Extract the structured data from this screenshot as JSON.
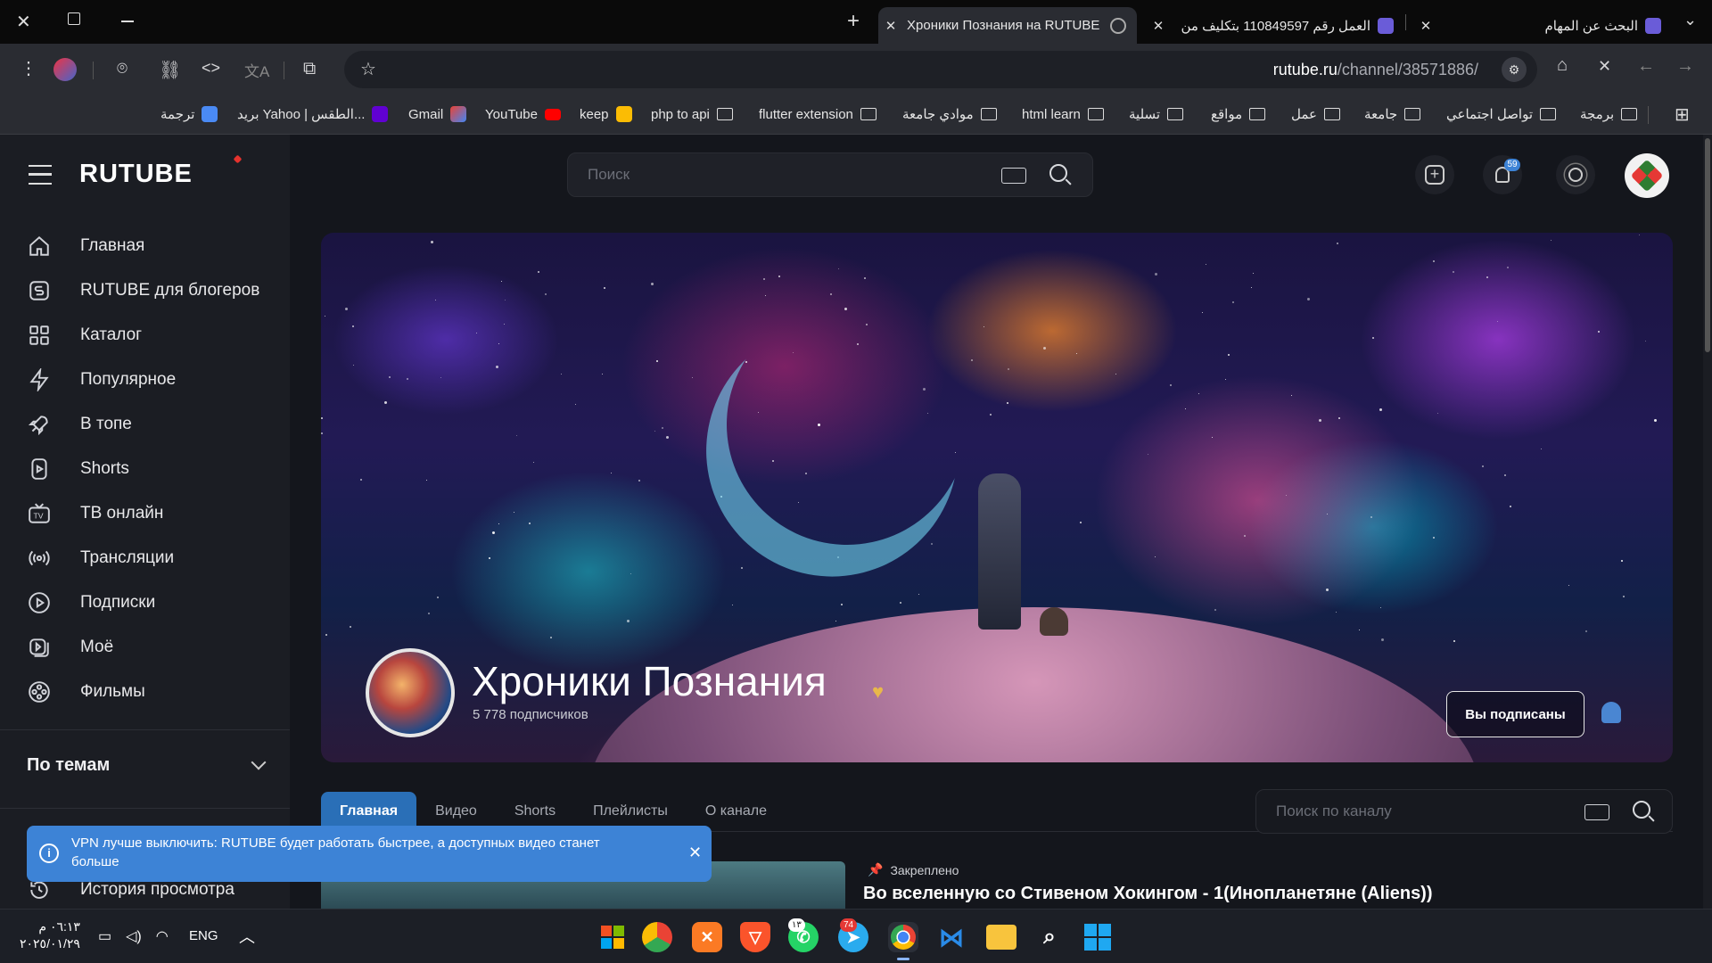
{
  "browser": {
    "tabs": [
      {
        "title": "Хроники Познания на RUTUBE",
        "active": true
      },
      {
        "title": "العمل رقم 110849597 بتكليف من",
        "active": false
      },
      {
        "title": "البحث عن المهام",
        "active": false
      }
    ],
    "url_domain": "rutube.ru",
    "url_path": "/channel/38571886/",
    "bookmarks": [
      "ترجمة",
      "بريد Yahoo | الطقس...",
      "Gmail",
      "YouTube",
      "keep",
      "php to api",
      "flutter extension",
      "موادي جامعة",
      "html learn",
      "تسلية",
      "مواقع",
      "عمل",
      "جامعة",
      "تواصل اجتماعي",
      "برمجة"
    ]
  },
  "header": {
    "logo": "RUTUBE",
    "search_placeholder": "Поиск",
    "notifications_count": "59"
  },
  "sidebar": {
    "items": [
      {
        "label": "Главная",
        "icon": "home-icon"
      },
      {
        "label": "RUTUBE для блогеров",
        "icon": "studio-icon"
      },
      {
        "label": "Каталог",
        "icon": "grid-icon"
      },
      {
        "label": "Популярное",
        "icon": "lightning-icon"
      },
      {
        "label": "В топе",
        "icon": "rocket-icon"
      },
      {
        "label": "Shorts",
        "icon": "shorts-icon"
      },
      {
        "label": "ТВ онлайн",
        "icon": "tv-icon"
      },
      {
        "label": "Трансляции",
        "icon": "broadcast-icon"
      },
      {
        "label": "Подписки",
        "icon": "subscriptions-icon"
      },
      {
        "label": "Моё",
        "icon": "library-icon"
      },
      {
        "label": "Фильмы",
        "icon": "film-reel-icon"
      }
    ],
    "section_title": "По темам",
    "history_label": "История просмотра"
  },
  "channel": {
    "name": "Хроники Познания",
    "subscribers": "5 778 подписчиков",
    "subscribed_label": "Вы подписаны",
    "tabs": [
      "Главная",
      "Видео",
      "Shorts",
      "Плейлисты",
      "О канале"
    ],
    "search_placeholder": "Поиск по каналу",
    "pinned_label": "Закреплено",
    "pinned_video_title": "Во вселенную со Стивеном Хокингом - 1(Инопланетяне (Aliens))"
  },
  "toast": {
    "message": "VPN лучше выключить: RUTUBE будет работать быстрее, а доступных видео станет больше"
  },
  "taskbar": {
    "time": "٠٦:١٣ م",
    "date": "٢٠٢٥/٠١/٢٩",
    "language": "ENG",
    "whatsapp_badge": "١٣",
    "telegram_badge": "74"
  },
  "colors": {
    "accent": "#2a6fb7",
    "toast": "#3d83d6",
    "sidebar_bg": "#1b1d23",
    "page_bg": "#14161c"
  }
}
